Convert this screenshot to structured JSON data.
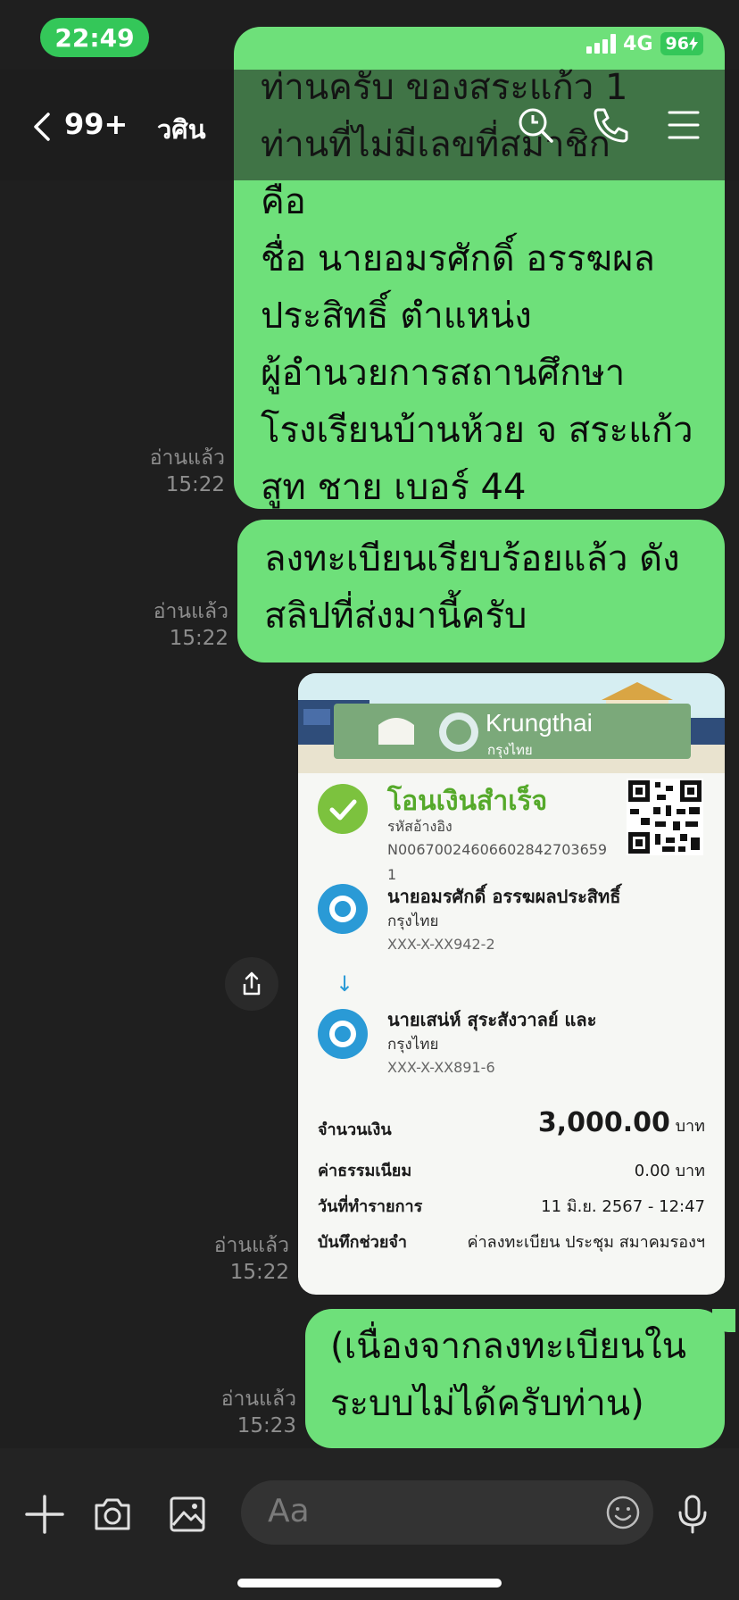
{
  "status": {
    "time": "22:49",
    "network": "4G",
    "battery": "96"
  },
  "header": {
    "unread_count": "99+",
    "contact_name": "วศิน"
  },
  "messages": {
    "m1": {
      "text": "ท่านครับ ของสระแก้ว 1\nท่านที่ไม่มีเลขที่สมาชิก\nคือ\nชื่อ นายอมรศักดิ์ อรรฆผล\nประสิทธิ์ ตำแหน่ง\nผู้อำนวยการสถานศึกษา\nโรงเรียนบ้านห้วย จ สระแก้ว\nสูท ชาย เบอร์ 44",
      "read": "อ่านแล้ว",
      "time": "15:22"
    },
    "m2": {
      "text": "ลงทะเบียนเรียบร้อยแล้ว ดัง\nสลิปที่ส่งมานี้ครับ",
      "read": "อ่านแล้ว",
      "time": "15:22"
    },
    "m3": {
      "read": "อ่านแล้ว",
      "time": "15:22"
    },
    "m4": {
      "text": "(เนื่องจากลงทะเบียนใน\nระบบไม่ได้ครับท่าน)",
      "read": "อ่านแล้ว",
      "time": "15:23"
    }
  },
  "slip": {
    "bank_name": "Krungthai",
    "bank_name_th": "กรุงไทย",
    "title": "โอนเงินสำเร็จ",
    "ref_label": "รหัสอ้างอิง",
    "ref_value": "N006700246066028427036591",
    "sender": {
      "name": "นายอมรศักดิ์ อรรฆผลประสิทธิ์",
      "bank": "กรุงไทย",
      "account": "XXX-X-XX942-2"
    },
    "receiver": {
      "name": "นายเสน่ห์ สุระสังวาลย์ และ",
      "bank": "กรุงไทย",
      "account": "XXX-X-XX891-6"
    },
    "amount_label": "จำนวนเงิน",
    "amount": "3,000.00",
    "unit": "บาท",
    "fee_label": "ค่าธรรมเนียม",
    "fee": "0.00",
    "date_label": "วันที่ทำรายการ",
    "date": "11 มิ.ย. 2567 - 12:47",
    "memo_label": "บันทึกช่วยจำ",
    "memo": "ค่าลงทะเบียน ประชุม สมาคมรองฯ"
  },
  "input": {
    "placeholder": "Aa"
  },
  "icons": {
    "back": "chevron-left-icon",
    "search": "search-icon",
    "call": "phone-icon",
    "menu": "menu-icon",
    "share": "share-icon",
    "plus": "plus-icon",
    "camera": "camera-icon",
    "image": "image-icon",
    "emoji": "emoji-icon",
    "mic": "microphone-icon"
  },
  "colors": {
    "bubble": "#6ee07a",
    "background": "#1f1f1f",
    "accent": "#34c759"
  }
}
